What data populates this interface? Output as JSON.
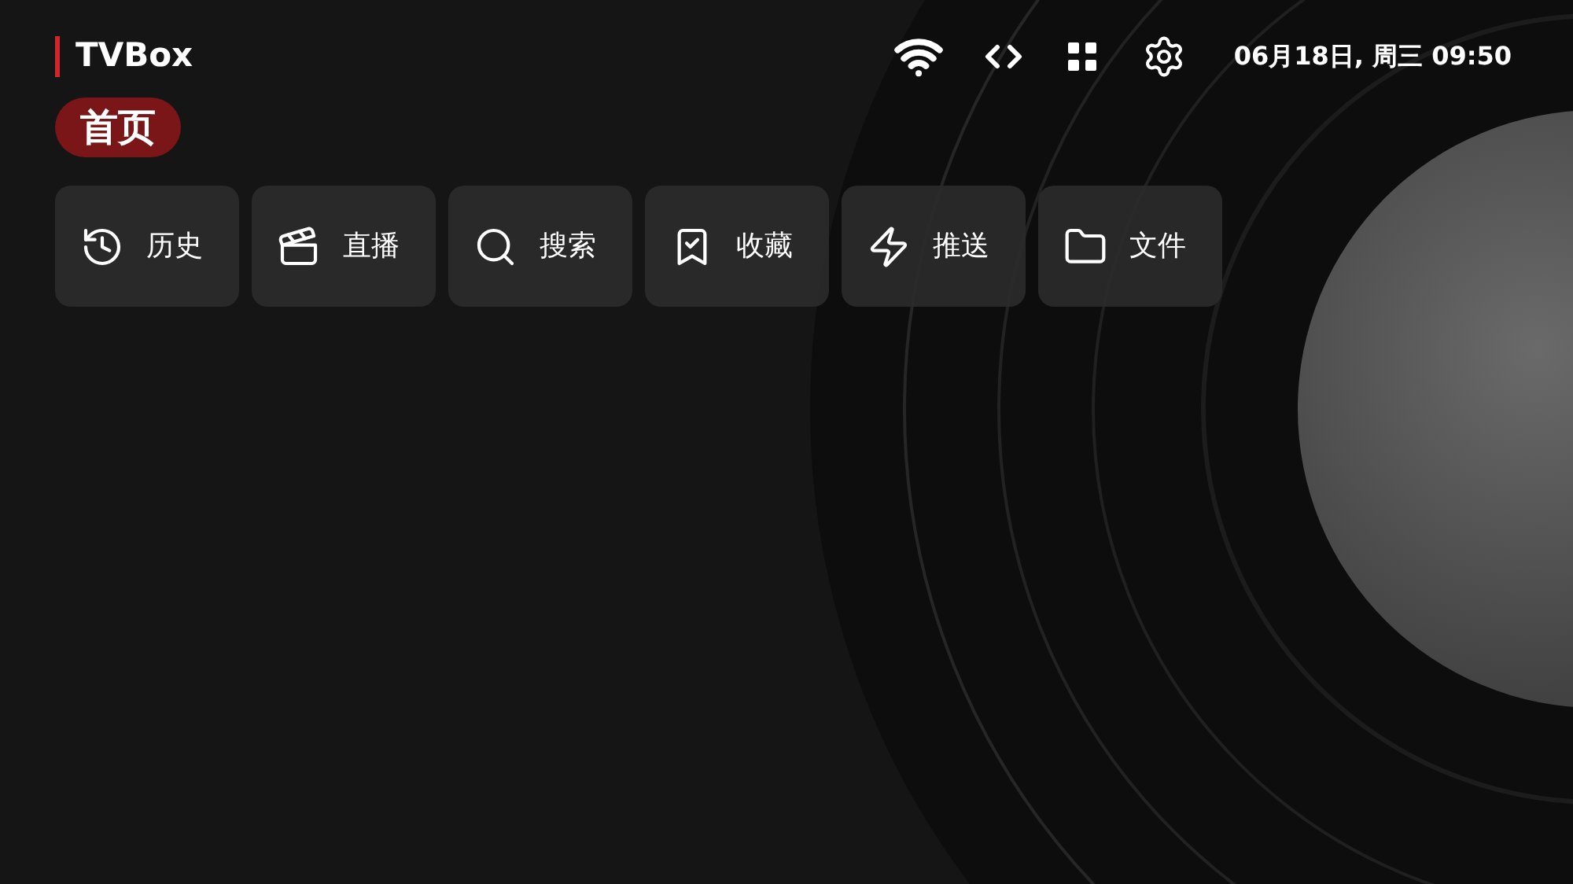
{
  "app_title": "TVBox",
  "status": {
    "datetime": "06月18日, 周三 09:50"
  },
  "tabs": [
    {
      "label": "首页",
      "selected": true
    }
  ],
  "tiles": [
    {
      "label": "历史"
    },
    {
      "label": "直播"
    },
    {
      "label": "搜索"
    },
    {
      "label": "收藏"
    },
    {
      "label": "推送"
    },
    {
      "label": "文件"
    }
  ]
}
